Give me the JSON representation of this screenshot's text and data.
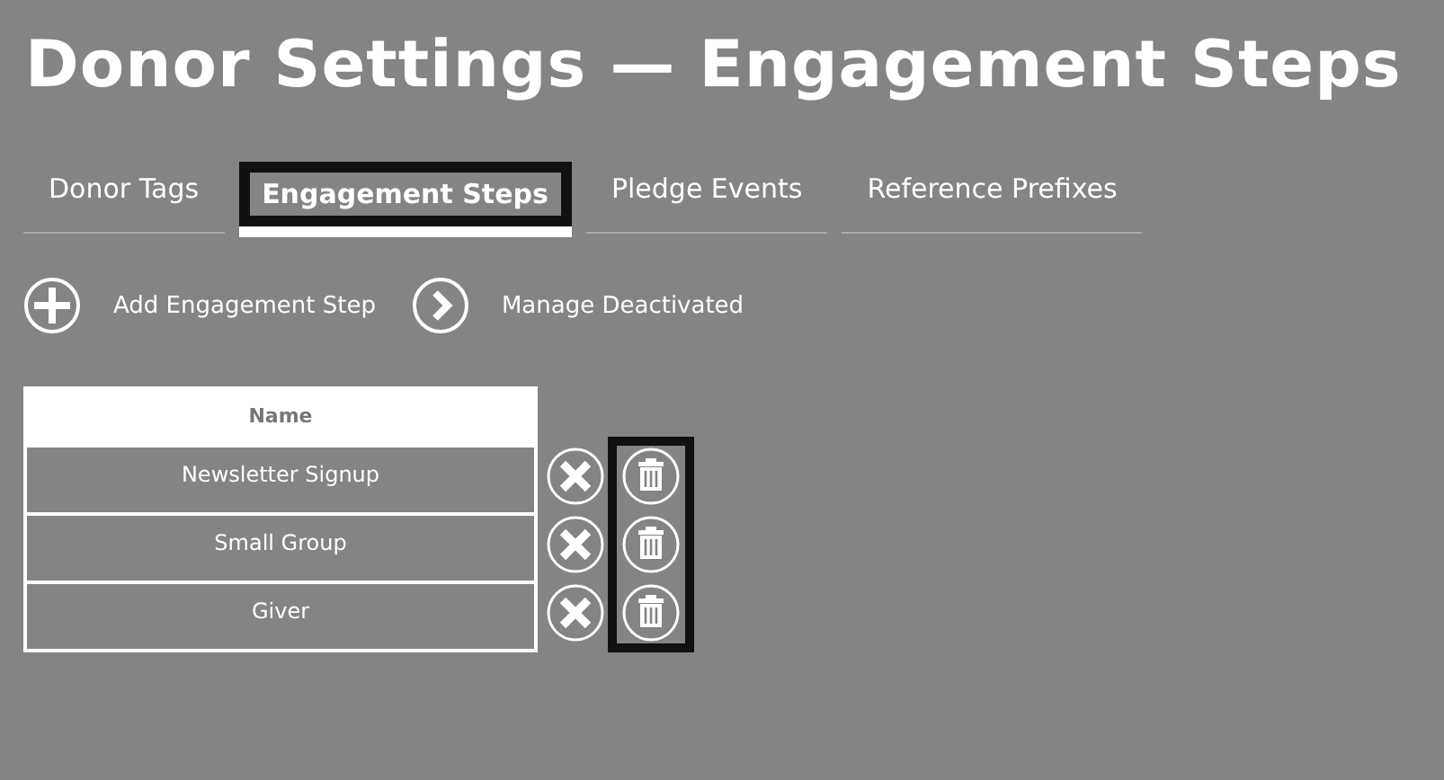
{
  "page": {
    "title": "Donor Settings — Engagement Steps"
  },
  "tabs": [
    {
      "label": "Donor Tags",
      "selected": false
    },
    {
      "label": "Engagement Steps",
      "selected": true
    },
    {
      "label": "Pledge Events",
      "selected": false
    },
    {
      "label": "Reference Prefixes",
      "selected": false
    }
  ],
  "actions": [
    {
      "kind": "add",
      "label": "Add Engagement Step"
    },
    {
      "kind": "next",
      "label": "Manage Deactivated"
    }
  ],
  "table": {
    "columns": [
      "Name"
    ],
    "rows": [
      {
        "name": "Newsletter Signup"
      },
      {
        "name": "Small Group"
      },
      {
        "name": "Giver"
      }
    ]
  }
}
